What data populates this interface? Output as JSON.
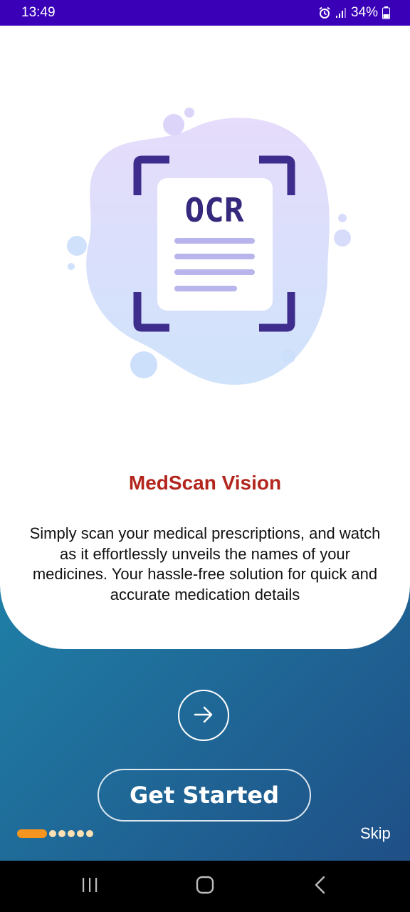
{
  "status_bar": {
    "time": "13:49",
    "battery": "34%",
    "icons": [
      "alarm-icon",
      "signal-icon",
      "battery-icon"
    ],
    "background_color": "#3a00b8"
  },
  "illustration": {
    "ocr_label": "OCR",
    "icon": "ocr-document-scan-illustration"
  },
  "onboarding": {
    "title": "MedScan Vision",
    "description": "Simply scan your medical prescriptions, and watch as it effortlessly unveils the names of your medicines. Your hassle-free solution for quick and accurate medication details",
    "title_color": "#b3261e"
  },
  "actions": {
    "next_icon": "arrow-right-icon",
    "get_started_label": "Get Started",
    "skip_label": "Skip"
  },
  "page_indicator": {
    "total": 6,
    "current": 1,
    "active_color": "#f5941e",
    "inactive_color": "#fde0b3"
  },
  "nav_bar": {
    "icons": [
      "recent-apps-icon",
      "home-icon",
      "back-icon"
    ]
  }
}
